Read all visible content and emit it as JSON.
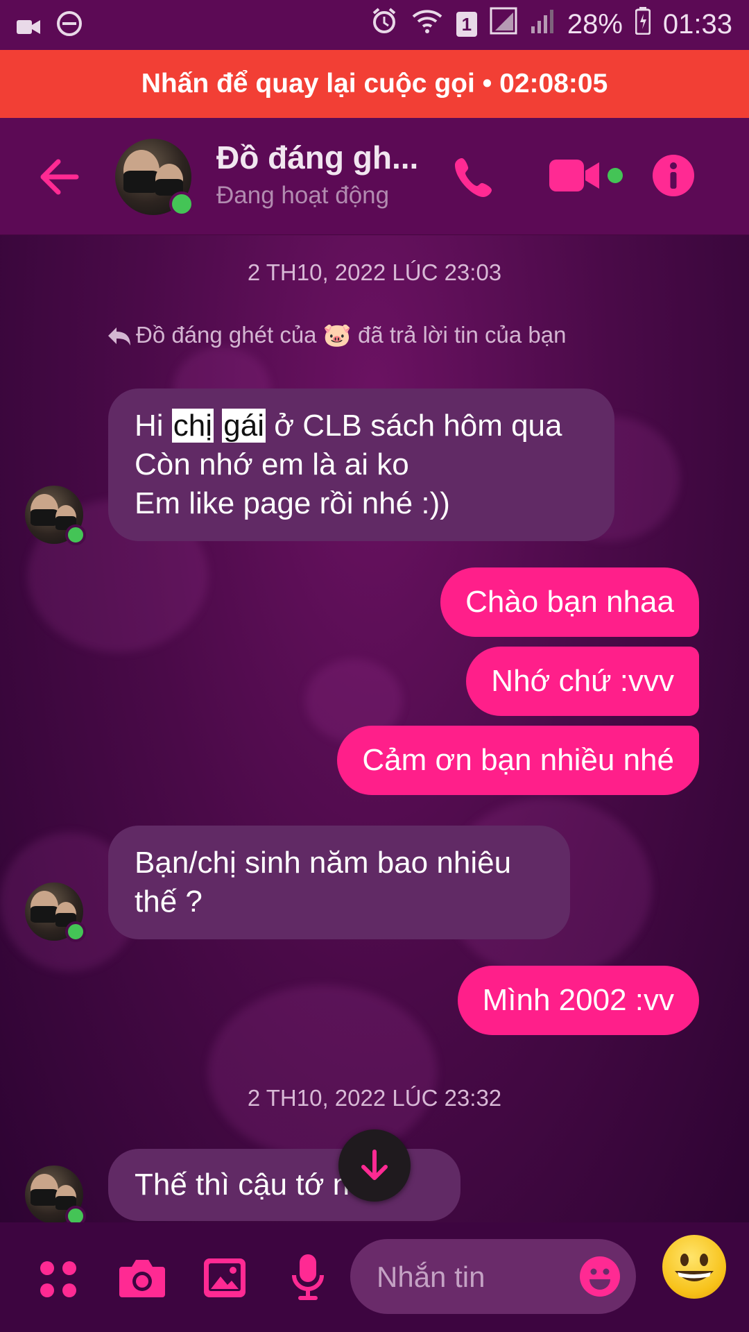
{
  "status_bar": {
    "battery": "28%",
    "time": "01:33",
    "sim_badge": "1"
  },
  "call_banner": {
    "text": "Nhấn để quay lại cuộc gọi • 02:08:05"
  },
  "header": {
    "name": "Đồ đáng gh...",
    "status": "Đang hoạt động"
  },
  "chat": {
    "date1": "2 TH10, 2022 LÚC 23:03",
    "reply_note": "Đồ đáng ghét của 🐷 đã trả lời tin của bạn",
    "msg1": {
      "pre": "Hi ",
      "hl1": "chị",
      "mid": " ",
      "hl2": "gái",
      "post": " ở CLB sách hôm qua",
      "line2": "Còn nhớ em là ai ko",
      "line3": "Em like page rồi nhé :))"
    },
    "out1": "Chào bạn nhaa",
    "out2": "Nhớ chứ :vvv",
    "out3": "Cảm ơn bạn nhiều nhé",
    "msg2_line1": "Bạn/chị sinh năm bao nhiêu",
    "msg2_line2": "thế ?",
    "out4": "Mình 2002 :vv",
    "date2": "2 TH10, 2022 LÚC 23:32",
    "msg3": "Thế thì cậu tớ n"
  },
  "composer": {
    "placeholder": "Nhắn tin"
  },
  "colors": {
    "accent": "#ff1f8a",
    "banner": "#f23f35",
    "header": "#5c0a55",
    "online": "#44c456"
  }
}
